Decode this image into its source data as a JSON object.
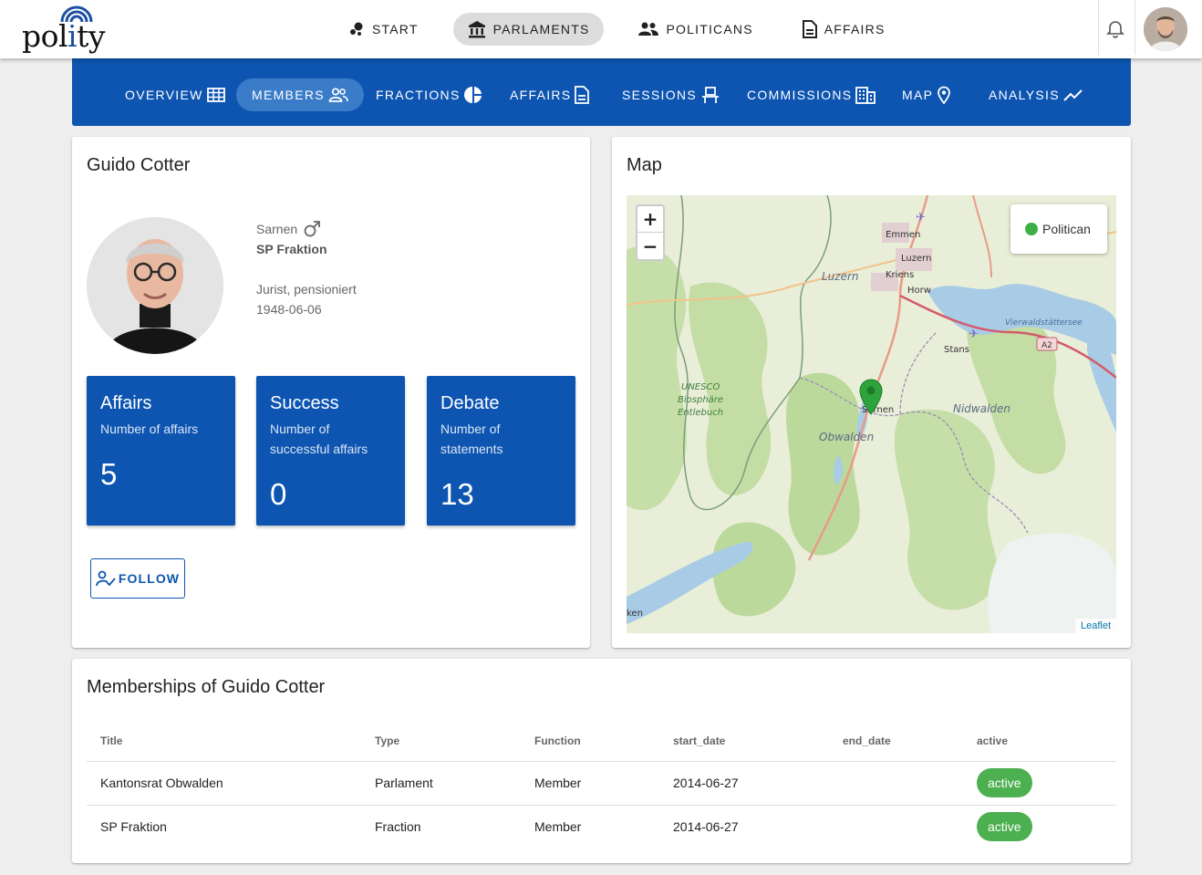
{
  "app": {
    "logo_text_pre": "pol",
    "logo_text_i": "i",
    "logo_text_post": "ty"
  },
  "main_nav": [
    {
      "label": "START",
      "icon": "bubble-chart-icon",
      "active": false
    },
    {
      "label": "PARLAMENTS",
      "icon": "institution-icon",
      "active": true
    },
    {
      "label": "POLITICANS",
      "icon": "people-icon",
      "active": false
    },
    {
      "label": "AFFAIRS",
      "icon": "document-icon",
      "active": false
    }
  ],
  "sub_nav": [
    {
      "label": "OVERVIEW",
      "icon": "grid-icon",
      "active": false
    },
    {
      "label": "MEMBERS",
      "icon": "people-icon",
      "active": true
    },
    {
      "label": "FRACTIONS",
      "icon": "pie-chart-icon",
      "active": false
    },
    {
      "label": "AFFAIRS",
      "icon": "document-icon",
      "active": false
    },
    {
      "label": "SESSIONS",
      "icon": "seat-icon",
      "active": false
    },
    {
      "label": "COMMISSIONS",
      "icon": "building-icon",
      "active": false
    },
    {
      "label": "MAP",
      "icon": "map-marker-icon",
      "active": false
    },
    {
      "label": "ANALYSIS",
      "icon": "trend-icon",
      "active": false
    }
  ],
  "profile": {
    "name": "Guido Cotter",
    "city": "Sarnen",
    "gender_icon": "male-icon",
    "fraction": "SP Fraktion",
    "occupation": "Jurist, pensioniert",
    "birthdate": "1948-06-06",
    "follow_label": "FOLLOW"
  },
  "stats": [
    {
      "title": "Affairs",
      "subtitle": "Number of affairs",
      "value": "5"
    },
    {
      "title": "Success",
      "subtitle": "Number of successful affairs",
      "value": "0"
    },
    {
      "title": "Debate",
      "subtitle": "Number of statements",
      "value": "13"
    }
  ],
  "map": {
    "title": "Map",
    "zoom_in": "+",
    "zoom_out": "−",
    "legend_label": "Politican",
    "legend_color": "#3cb043",
    "attribution": "Leaflet",
    "place_labels": {
      "emmen": "Emmen",
      "luzern_city": "Luzern",
      "luzern_region": "Luzern",
      "kriens": "Kriens",
      "horw": "Horw",
      "vierwald": "Vierwaldstättersee",
      "stans": "Stans",
      "a2": "A2",
      "unesco1": "UNESCO",
      "unesco2": "Biosphäre",
      "unesco3": "Entlebuch",
      "sarnen": "Sarnen",
      "obwalden": "Obwalden",
      "nidwalden": "Nidwalden",
      "ken": "ken"
    }
  },
  "memberships": {
    "title": "Memberships of Guido Cotter",
    "headers": [
      "Title",
      "Type",
      "Function",
      "start_date",
      "end_date",
      "active"
    ],
    "rows": [
      {
        "title": "Kantonsrat Obwalden",
        "type": "Parlament",
        "function": "Member",
        "start_date": "2014-06-27",
        "end_date": "",
        "active": "active"
      },
      {
        "title": "SP Fraktion",
        "type": "Fraction",
        "function": "Member",
        "start_date": "2014-06-27",
        "end_date": "",
        "active": "active"
      }
    ]
  },
  "colors": {
    "primary": "#0d55b1",
    "active_badge": "#4caf50"
  }
}
